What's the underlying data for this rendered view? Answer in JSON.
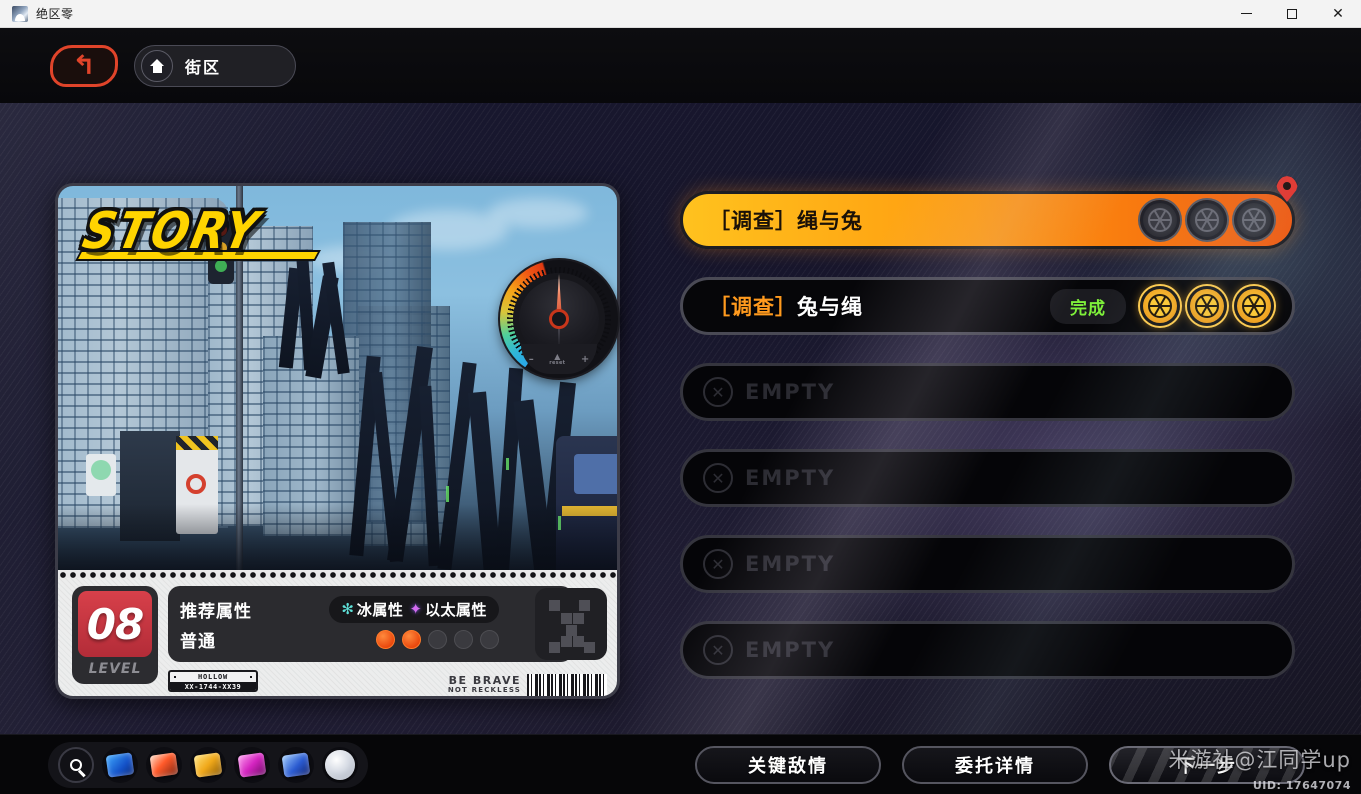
{
  "window": {
    "title": "绝区零",
    "controls": {
      "minimize": "minimize-button",
      "maximize": "maximize-button",
      "close": "close-button"
    }
  },
  "topnav": {
    "back_label": "↰",
    "home_icon": "home-icon",
    "breadcrumb": "街区"
  },
  "story_card": {
    "logo": "STORY",
    "level_number": "08",
    "level_word": "LEVEL",
    "recommend_label": "推荐属性",
    "difficulty_label": "普通",
    "attributes": [
      {
        "icon": "ice-icon",
        "glyph": "✻",
        "label": "冰属性",
        "color": "#5ee0d8"
      },
      {
        "icon": "ether-icon",
        "glyph": "✦",
        "label": "以太属性",
        "color": "#d46cf0"
      }
    ],
    "difficulty_dots": {
      "filled": 2,
      "total": 5,
      "color": "#ef5a14"
    },
    "plate_top": "HOLLOW",
    "plate_bottom": "XX-1744-XX39",
    "brave_line1": "BE BRAVE",
    "brave_line2": "NOT RECKLESS"
  },
  "gauge": {
    "name": "hollow-level-gauge",
    "minus": "–",
    "plus": "+",
    "center_triangle": "▲",
    "center_label": "reset"
  },
  "missions": [
    {
      "title_tag": "［调查］",
      "title_text": "绳与兔",
      "state": "active",
      "status": "",
      "medals": 3,
      "medal_style": "dark"
    },
    {
      "title_tag": "［调查］",
      "title_text": "兔与绳",
      "state": "done",
      "status": "完成",
      "medals": 3,
      "medal_style": "gold"
    },
    {
      "title_tag": "",
      "title_text": "EMPTY",
      "state": "empty",
      "status": "",
      "medals": 0,
      "medal_style": "none"
    },
    {
      "title_tag": "",
      "title_text": "EMPTY",
      "state": "empty",
      "status": "",
      "medals": 0,
      "medal_style": "none"
    },
    {
      "title_tag": "",
      "title_text": "EMPTY",
      "state": "empty",
      "status": "",
      "medals": 0,
      "medal_style": "none"
    },
    {
      "title_tag": "",
      "title_text": "EMPTY",
      "state": "empty",
      "status": "",
      "medals": 0,
      "medal_style": "none"
    }
  ],
  "toolbar": {
    "search_icon": "search-icon",
    "items": [
      "globe-chip-icon",
      "card-chip-icon",
      "gold-chip-icon",
      "magenta-chip-icon",
      "blue-chip-icon",
      "disc-icon"
    ]
  },
  "actions": {
    "enemy_intel": "关键敌情",
    "commission_detail": "委托详情",
    "next_step": "下一步"
  },
  "watermark": {
    "text": "米游社@江同学up",
    "uid": "UID: 17647074"
  },
  "colors": {
    "accent_orange": "#ff9b0f",
    "accent_gold": "#ffc21e",
    "status_green": "#7ef03a",
    "back_red": "#e0442a",
    "ice": "#5ee0d8",
    "ether": "#d46cf0"
  }
}
